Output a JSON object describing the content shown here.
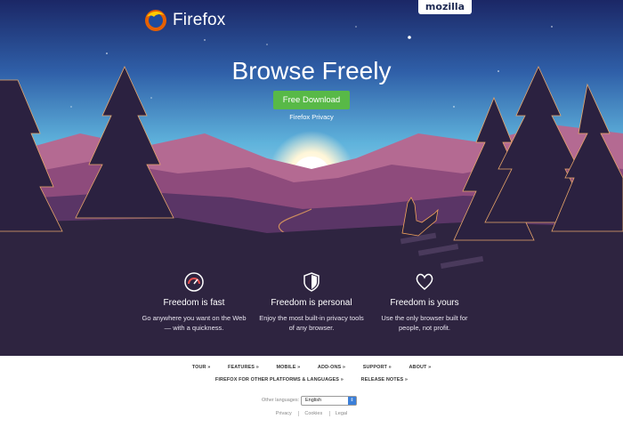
{
  "header": {
    "brand": "Firefox",
    "mozilla_tab": "mozilla"
  },
  "hero": {
    "headline": "Browse Freely",
    "download_label": "Free Download",
    "privacy_link": "Firefox Privacy"
  },
  "features": [
    {
      "icon": "speedometer-icon",
      "title": "Freedom is fast",
      "desc": "Go anywhere you want on the Web — with a quickness."
    },
    {
      "icon": "shield-icon",
      "title": "Freedom is personal",
      "desc": "Enjoy the most built-in privacy tools of any browser."
    },
    {
      "icon": "heart-icon",
      "title": "Freedom is yours",
      "desc": "Use the only browser built for people, not profit."
    }
  ],
  "footer": {
    "nav": [
      "TOUR »",
      "FEATURES »",
      "MOBILE »",
      "ADD-ONS »",
      "SUPPORT »",
      "ABOUT »"
    ],
    "nav2": [
      "FIREFOX FOR OTHER PLATFORMS & LANGUAGES »",
      "RELEASE NOTES »"
    ],
    "language_label": "Other languages:",
    "language_value": "English",
    "legal": [
      "Privacy",
      "Cookies",
      "Legal"
    ]
  },
  "colors": {
    "sky_top": "#1c2d6e",
    "sky_bottom": "#4aa3d8",
    "ground": "#2e2440",
    "button": "#58b947"
  }
}
